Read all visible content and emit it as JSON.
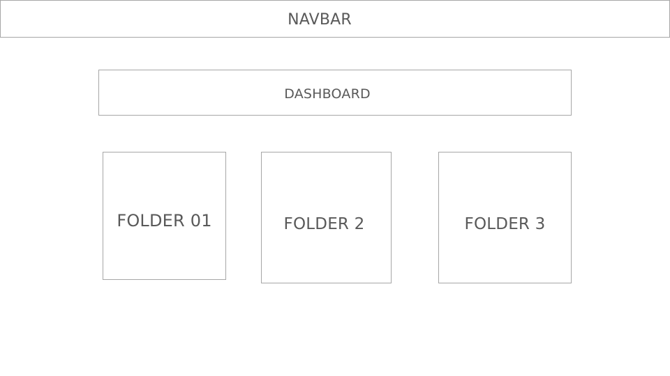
{
  "navbar": {
    "label": "NAVBAR"
  },
  "dashboard": {
    "label": "DASHBOARD"
  },
  "folders": [
    {
      "label": "FOLDER 01"
    },
    {
      "label": "FOLDER 2"
    },
    {
      "label": "FOLDER 3"
    }
  ]
}
